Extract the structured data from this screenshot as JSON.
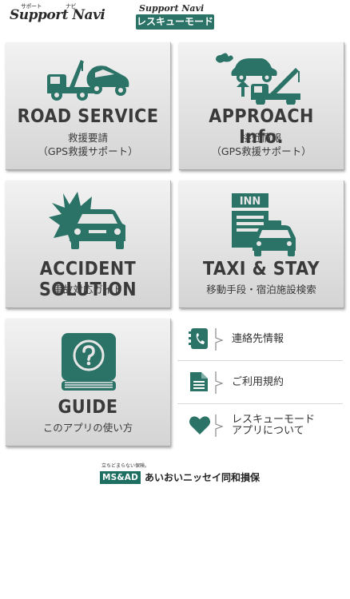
{
  "header": {
    "logo_text": "Support Navi",
    "logo_small_left": "サポート",
    "logo_small_right": "ナビ",
    "rescue_logo_text": "Support Navi",
    "rescue_badge": "レスキューモード"
  },
  "tiles": {
    "road": {
      "title": "ROAD SERVICE",
      "sub1": "救援要請",
      "sub2": "（GPS救援サポート）"
    },
    "approach": {
      "title": "APPROACH Info.",
      "sub1": "接近情報",
      "sub2": "（GPS救援サポート）"
    },
    "accident": {
      "title": "ACCIDENT SOLUTION",
      "sub1": "事故対応ガイド"
    },
    "taxi": {
      "title": "TAXI & STAY",
      "sub1": "移動手段・宿泊施設検索",
      "inn_sign": "INN"
    },
    "guide": {
      "title": "GUIDE",
      "sub1": "このアプリの使い方"
    }
  },
  "side_menu": {
    "contacts": "連絡先情報",
    "terms": "ご利用規約",
    "about_line1": "レスキューモード",
    "about_line2": "アプリについて"
  },
  "footer": {
    "tagline": "立ちどまらない保険。",
    "brand": "MS&AD",
    "company": "あいおいニッセイ同和損保"
  },
  "colors": {
    "accent": "#2b7367",
    "tile_text": "#3a3a3a"
  }
}
